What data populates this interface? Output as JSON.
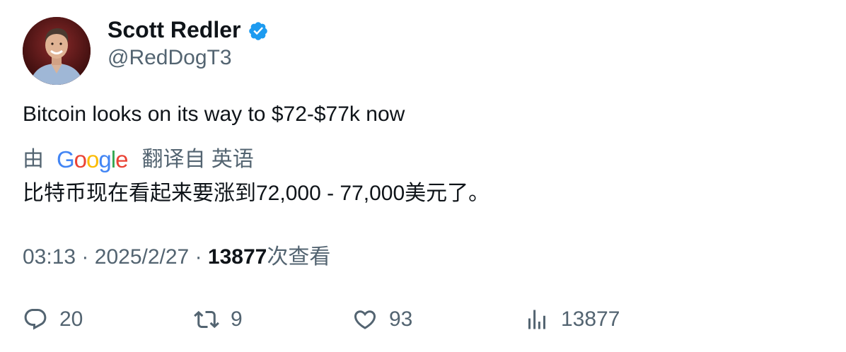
{
  "author": {
    "display_name": "Scott Redler",
    "handle": "@RedDogT3",
    "verified_icon": "verified-badge-icon",
    "verified_color": "#1d9bf0"
  },
  "tweet": {
    "text": "Bitcoin looks on its way to $72-$77k now"
  },
  "translation": {
    "prefix": "由",
    "provider_logo": "Google",
    "suffix": "翻译自 英语",
    "text": "比特币现在看起来要涨到72,000 - 77,000美元了。"
  },
  "meta": {
    "time": "03:13",
    "separator": "·",
    "date": "2025/2/27",
    "views_count": "13877",
    "views_label": "次查看"
  },
  "actions": {
    "reply_count": "20",
    "retweet_count": "9",
    "like_count": "93",
    "views_count": "13877"
  },
  "colors": {
    "text_primary": "#0f1419",
    "text_secondary": "#536471",
    "google_blue": "#4285F4",
    "google_red": "#EA4335",
    "google_yellow": "#FBBC05",
    "google_green": "#34A853"
  }
}
